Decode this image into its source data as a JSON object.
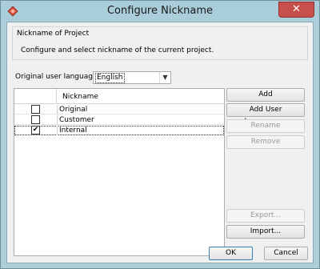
{
  "window": {
    "title": "Configure Nickname",
    "close_symbol": "✕"
  },
  "group": {
    "title": "Nickname of Project",
    "description": "Configure and select nickname of the current project."
  },
  "language": {
    "label": "Original user language:",
    "value": "English"
  },
  "table": {
    "header": "Nickname",
    "rows": [
      {
        "name": "Original",
        "checked": false
      },
      {
        "name": "Customer",
        "checked": false
      },
      {
        "name": "Internal",
        "checked": true
      }
    ]
  },
  "buttons": {
    "add": "Add",
    "add_user_language": "Add User Language...",
    "rename": "Rename",
    "remove": "Remove",
    "export": "Export...",
    "import": "Import...",
    "ok": "OK",
    "cancel": "Cancel"
  }
}
